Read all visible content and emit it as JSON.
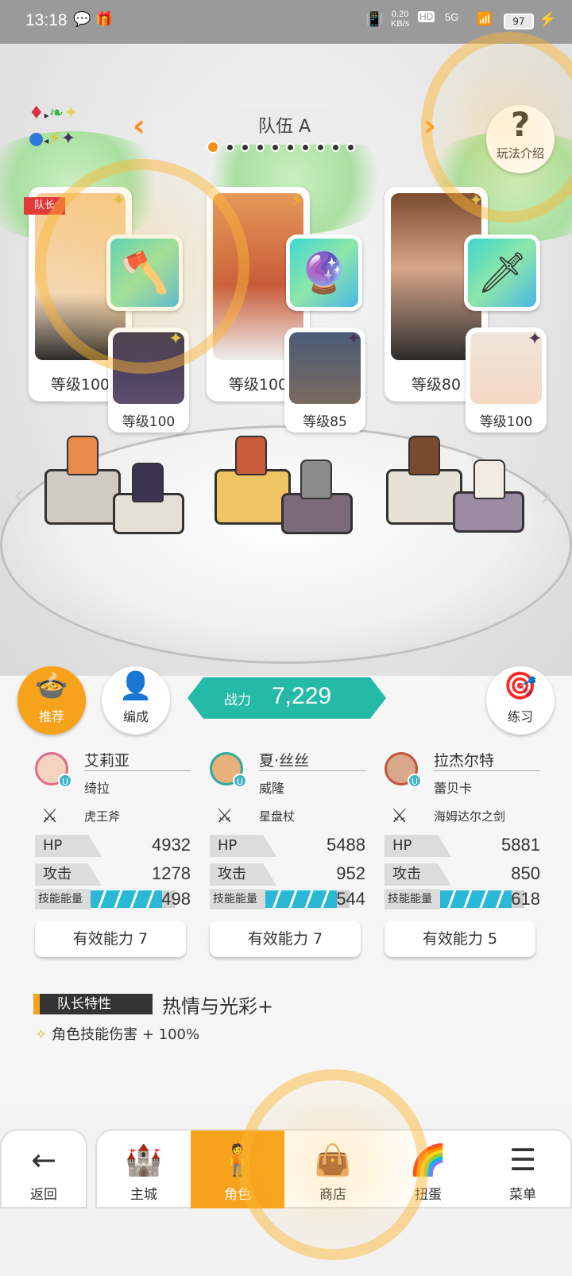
{
  "status_bar": {
    "time": "13:18",
    "net_speed": "0.20",
    "net_unit": "KB/s",
    "hd": "HD",
    "signal": "5G",
    "battery": "97"
  },
  "team": {
    "name": "队伍 A",
    "page_count": 10,
    "active_page": 0
  },
  "help": {
    "label": "玩法介绍"
  },
  "leader_tag": "队长",
  "cards": [
    {
      "level": "等级100",
      "sub_level": "等级100"
    },
    {
      "level": "等级100",
      "sub_level": "等级85"
    },
    {
      "level": "等级80",
      "sub_level": "等级100"
    }
  ],
  "actions": {
    "recommend": "推荐",
    "formation": "编成",
    "practice": "练习"
  },
  "power": {
    "label": "战力",
    "value": "7,229"
  },
  "characters": [
    {
      "name": "艾莉亚",
      "support": "绮拉",
      "weapon": "虎王斧",
      "hp_label": "HP",
      "hp": "4932",
      "atk_label": "攻击",
      "atk": "1278",
      "energy_label": "技能能量",
      "energy": "498",
      "ability": "有效能力 7"
    },
    {
      "name": "夏·丝丝",
      "support": "威隆",
      "weapon": "星盘杖",
      "hp_label": "HP",
      "hp": "5488",
      "atk_label": "攻击",
      "atk": "952",
      "energy_label": "技能能量",
      "energy": "544",
      "ability": "有效能力 7"
    },
    {
      "name": "拉杰尔特",
      "support": "蕾贝卡",
      "weapon": "海姆达尔之剑",
      "hp_label": "HP",
      "hp": "5881",
      "atk_label": "攻击",
      "atk": "850",
      "energy_label": "技能能量",
      "energy": "618",
      "ability": "有效能力 5"
    }
  ],
  "leader_trait": {
    "label": "队长特性",
    "name": "热情与光彩+",
    "effect": "角色技能伤害 + 100%"
  },
  "nav": {
    "back": "返回",
    "main_city": "主城",
    "character": "角色",
    "shop": "商店",
    "gacha": "扭蛋",
    "menu": "菜单"
  },
  "colors": {
    "accent": "#f7a21b",
    "power_bg": "#25b9a8",
    "energy_bar": "#2bb8d6",
    "leader_red": "#e03b3b"
  }
}
